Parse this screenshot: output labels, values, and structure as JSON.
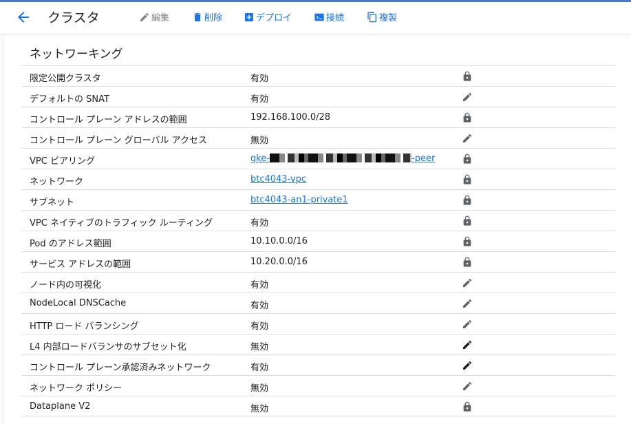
{
  "header": {
    "title": "クラスタ",
    "actions": {
      "edit": "編集",
      "delete": "削除",
      "deploy": "デプロイ",
      "connect": "接続",
      "duplicate": "複製"
    }
  },
  "section": {
    "title": "ネットワーキング"
  },
  "rows": [
    {
      "label": "限定公開クラスタ",
      "value": "有効",
      "icon": "lock-icon"
    },
    {
      "label": "デフォルトの SNAT",
      "value": "有効",
      "icon": "edit-icon"
    },
    {
      "label": "コントロール プレーン アドレスの範囲",
      "value": "192.168.100.0/28",
      "icon": "lock-icon"
    },
    {
      "label": "コントロール プレーン グローバル アクセス",
      "value": "無効",
      "icon": "edit-icon"
    },
    {
      "label": "VPC ピアリング",
      "value_prefix": "gke-",
      "value_suffix": "-peer",
      "icon": "lock-icon"
    },
    {
      "label": "ネットワーク",
      "value": "btc4043-vpc",
      "icon": "lock-icon"
    },
    {
      "label": "サブネット",
      "value": "btc4043-an1-private1",
      "icon": "lock-icon"
    },
    {
      "label": "VPC ネイティブのトラフィック ルーティング",
      "value": "有効",
      "icon": "lock-icon"
    },
    {
      "label": "Pod のアドレス範囲",
      "value": "10.10.0.0/16",
      "icon": "lock-icon"
    },
    {
      "label": "サービス アドレスの範囲",
      "value": "10.20.0.0/16",
      "icon": "lock-icon"
    },
    {
      "label": "ノード内の可視化",
      "value": "有効",
      "icon": "edit-icon"
    },
    {
      "label": "NodeLocal DNSCache",
      "value": "有効",
      "icon": "edit-icon"
    },
    {
      "label": "HTTP ロード バランシング",
      "value": "有効",
      "icon": "edit-icon"
    },
    {
      "label": "L4 内部ロードバランサのサブセット化",
      "value": "無効",
      "icon": "edit-icon"
    },
    {
      "label": "コントロール プレーン承認済みネットワーク",
      "value": "有効",
      "icon": "edit-icon"
    },
    {
      "label": "ネットワーク ポリシー",
      "value": "無効",
      "icon": "edit-icon"
    },
    {
      "label": "Dataplane V2",
      "value": "無効",
      "icon": "lock-icon"
    }
  ],
  "colors": {
    "accent": "#1a73e8",
    "icon_grey": "#5f6368",
    "icon_dark": "#202124"
  }
}
